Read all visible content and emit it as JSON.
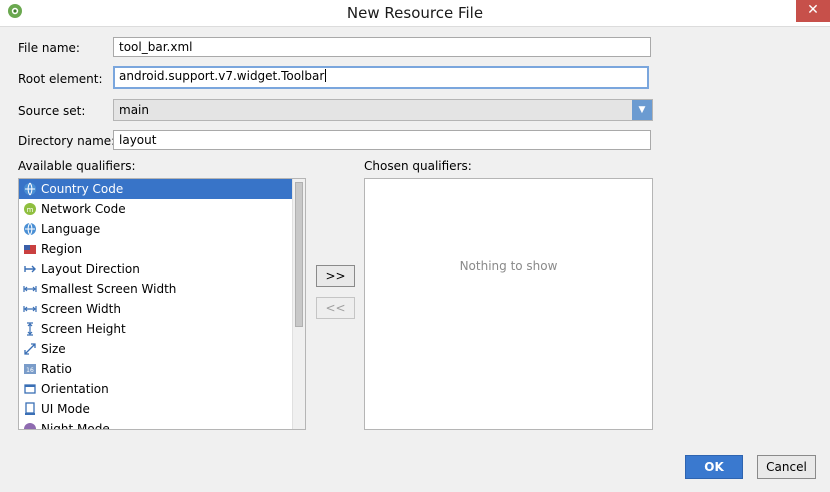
{
  "window": {
    "title": "New Resource File",
    "close_label": "✕"
  },
  "form": {
    "file_name": {
      "label": "File name:",
      "value": "tool_bar.xml"
    },
    "root_element": {
      "label": "Root element:",
      "value": "android.support.v7.widget.Toolbar"
    },
    "source_set": {
      "label": "Source set:",
      "value": "main"
    },
    "directory_name": {
      "label": "Directory name:",
      "value": "layout"
    }
  },
  "available": {
    "label": "Available qualifiers:",
    "items": [
      {
        "label": "Country Code",
        "icon": "globe-icon",
        "selected": true
      },
      {
        "label": "Network Code",
        "icon": "network-icon"
      },
      {
        "label": "Language",
        "icon": "globe-icon"
      },
      {
        "label": "Region",
        "icon": "region-flag-icon"
      },
      {
        "label": "Layout Direction",
        "icon": "layout-direction-icon"
      },
      {
        "label": "Smallest Screen Width",
        "icon": "width-icon"
      },
      {
        "label": "Screen Width",
        "icon": "width-icon"
      },
      {
        "label": "Screen Height",
        "icon": "height-icon"
      },
      {
        "label": "Size",
        "icon": "size-icon"
      },
      {
        "label": "Ratio",
        "icon": "ratio-icon"
      },
      {
        "label": "Orientation",
        "icon": "orientation-icon"
      },
      {
        "label": "UI Mode",
        "icon": "ui-mode-icon"
      },
      {
        "label": "Night Mode",
        "icon": "night-mode-icon"
      }
    ]
  },
  "chosen": {
    "label": "Chosen qualifiers:",
    "empty_text": "Nothing to show"
  },
  "buttons": {
    "add": ">>",
    "remove": "<<",
    "ok": "OK",
    "cancel": "Cancel"
  }
}
